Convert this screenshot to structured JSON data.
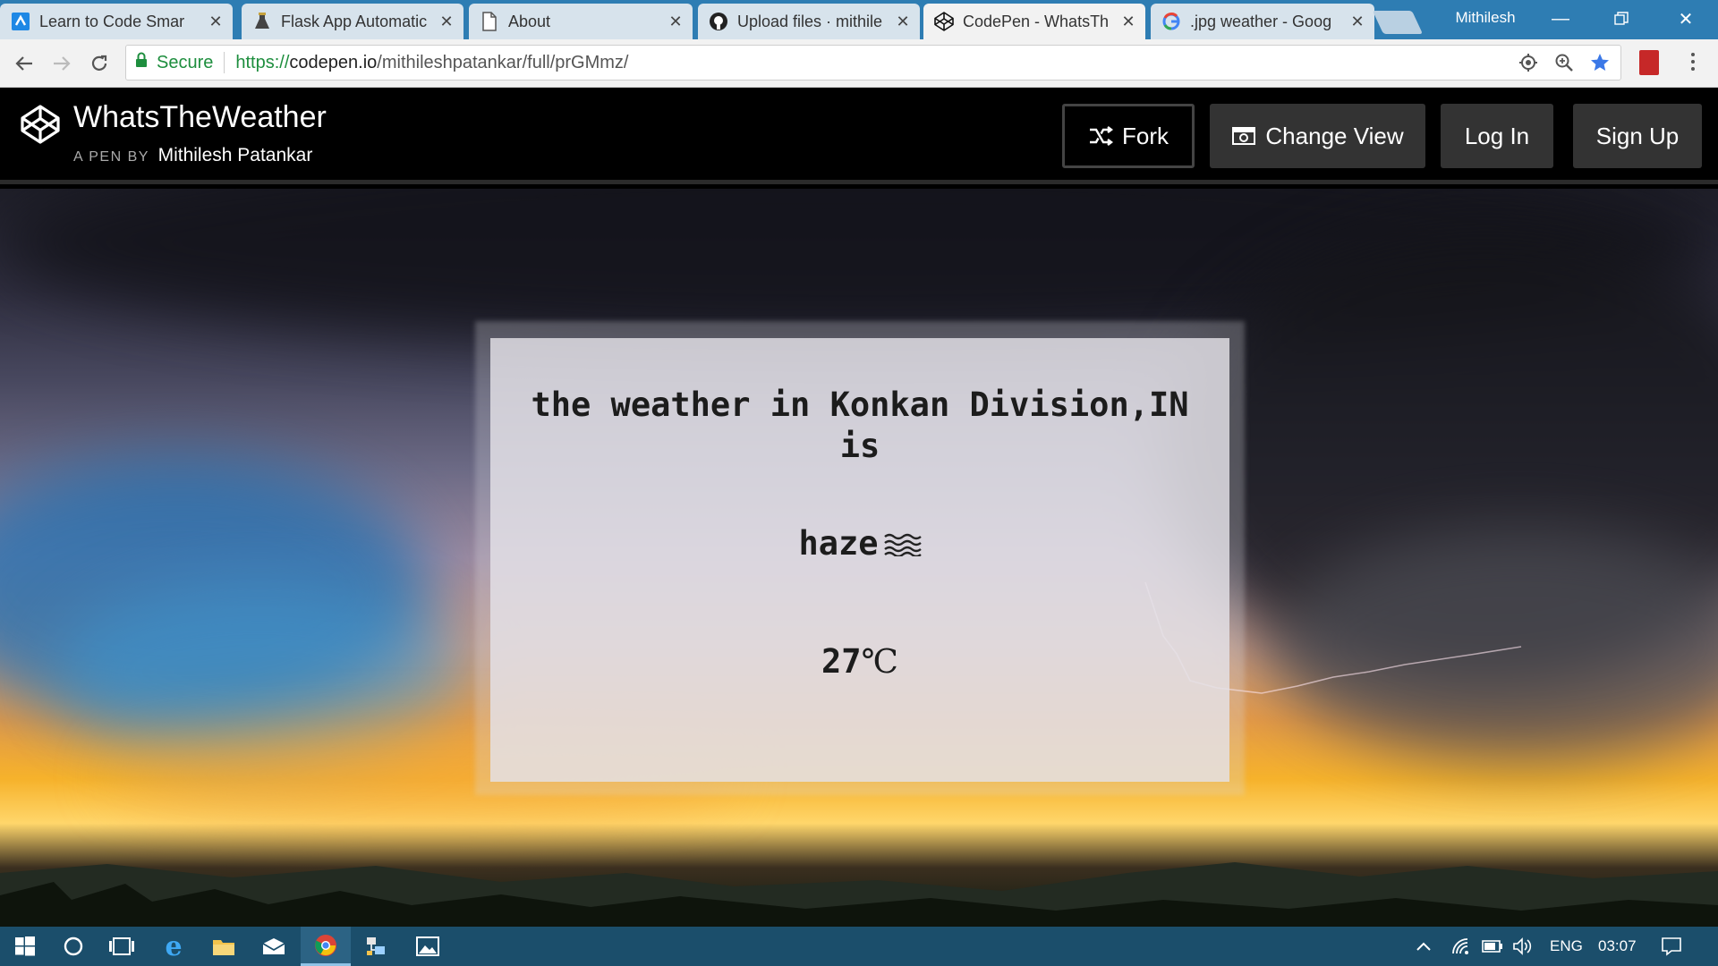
{
  "browser": {
    "tabs": [
      {
        "title": "Learn to Code Smar",
        "icon": "freecodecamp-icon",
        "active": false
      },
      {
        "title": "Flask App Automatic",
        "icon": "flask-icon",
        "active": false
      },
      {
        "title": "About",
        "icon": "page-icon",
        "active": false
      },
      {
        "title": "Upload files · mithile",
        "icon": "github-icon",
        "active": false
      },
      {
        "title": "CodePen - WhatsTh",
        "icon": "codepen-icon",
        "active": true
      },
      {
        "title": ".jpg weather - Goog",
        "icon": "google-icon",
        "active": false
      }
    ],
    "profile_name": "Mithilesh",
    "secure_label": "Secure",
    "url": {
      "scheme": "https://",
      "host": "codepen.io",
      "path": "/mithileshpatankar/full/prGMmz/"
    },
    "colors": {
      "tabstrip": "#2e7db3",
      "secure_green": "#1e8e3e"
    }
  },
  "codepen": {
    "title": "WhatsTheWeather",
    "byline_prefix": "A PEN BY",
    "author": "Mithilesh Patankar",
    "buttons": {
      "fork": "Fork",
      "change_view": "Change View",
      "log_in": "Log In",
      "sign_up": "Sign Up"
    }
  },
  "weather": {
    "headline": "the weather in Konkan Division,IN is",
    "condition": "haze",
    "condition_icon": "haze-icon",
    "temperature_value": "27",
    "temperature_unit": "℃"
  },
  "taskbar": {
    "items": [
      "start-icon",
      "cortana-icon",
      "task-view-icon",
      "edge-icon",
      "file-explorer-icon",
      "mail-icon",
      "chrome-icon",
      "network-app-icon",
      "photos-icon"
    ],
    "language": "ENG",
    "time": "03:07",
    "colors": {
      "background": "#1b4e6b"
    }
  }
}
